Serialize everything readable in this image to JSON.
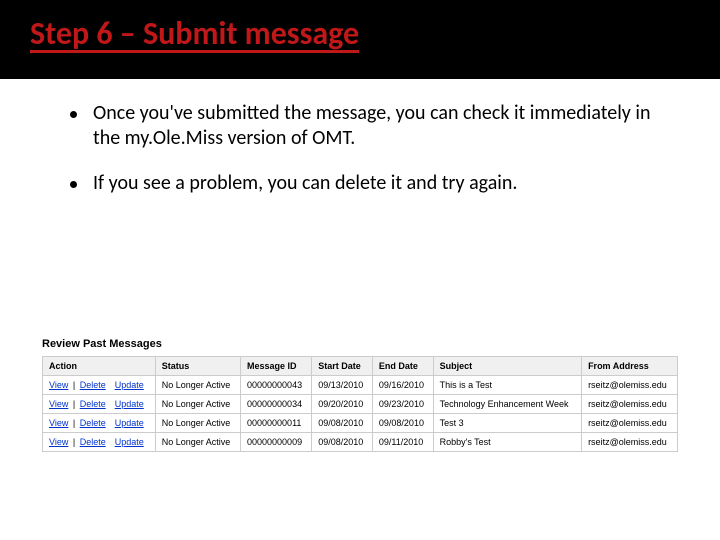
{
  "title": "Step 6 – Submit message",
  "bullets": [
    "Once you've submitted the message, you can check it immediately in the my.Ole.Miss version of OMT.",
    "If you see a problem, you can delete it and try again."
  ],
  "screenshot": {
    "heading": "Review Past Messages",
    "columns": [
      "Action",
      "Status",
      "Message ID",
      "Start Date",
      "End Date",
      "Subject",
      "From Address"
    ],
    "action_links": {
      "view": "View",
      "delete": "Delete",
      "update": "Update"
    },
    "rows": [
      {
        "status": "No Longer Active",
        "message_id": "00000000043",
        "start_date": "09/13/2010",
        "end_date": "09/16/2010",
        "subject": "This is a Test",
        "from": "rseitz@olemiss.edu"
      },
      {
        "status": "No Longer Active",
        "message_id": "00000000034",
        "start_date": "09/20/2010",
        "end_date": "09/23/2010",
        "subject": "Technology Enhancement Week",
        "from": "rseitz@olemiss.edu"
      },
      {
        "status": "No Longer Active",
        "message_id": "00000000011",
        "start_date": "09/08/2010",
        "end_date": "09/08/2010",
        "subject": "Test 3",
        "from": "rseitz@olemiss.edu"
      },
      {
        "status": "No Longer Active",
        "message_id": "00000000009",
        "start_date": "09/08/2010",
        "end_date": "09/11/2010",
        "subject": "Robby's Test",
        "from": "rseitz@olemiss.edu"
      }
    ]
  }
}
